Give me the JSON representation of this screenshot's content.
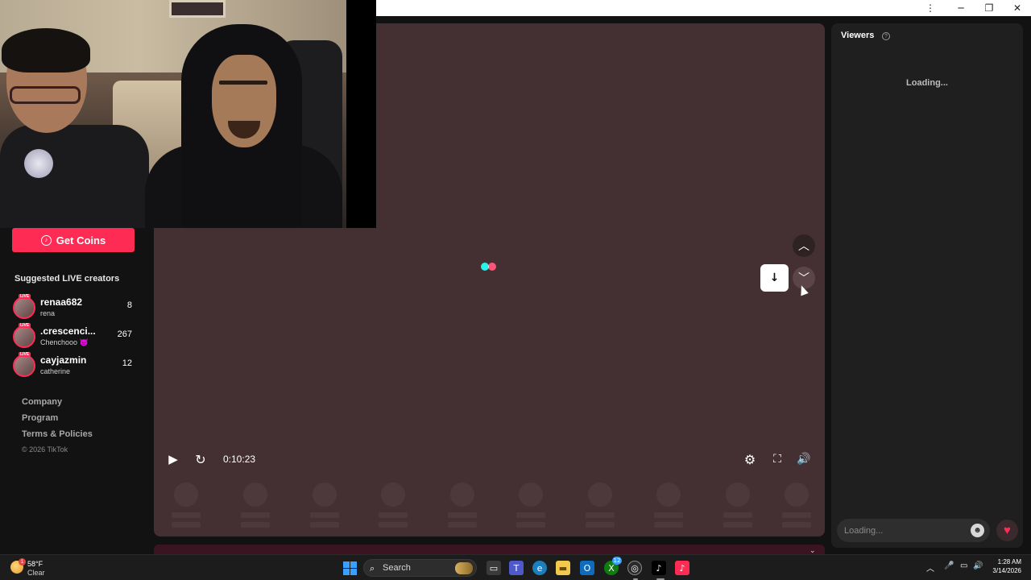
{
  "window": {
    "menu_icon": "kebab-menu-icon",
    "minimize": "minimize-icon",
    "restore": "restore-icon",
    "close": "close-icon"
  },
  "sidebar": {
    "get_coins_label": "Get Coins",
    "suggested_title": "Suggested LIVE creators",
    "creators": [
      {
        "name": "renaa682",
        "sub": "rena",
        "count": "8"
      },
      {
        "name": ".crescenci...",
        "sub": "Chenchooo 😈",
        "count": "267"
      },
      {
        "name": "cayjazmin",
        "sub": "catherine",
        "count": "12"
      }
    ],
    "live_tag": "LIVE",
    "footer": [
      "Company",
      "Program",
      "Terms & Policies"
    ],
    "copyright": "© 2026 TikTok"
  },
  "player": {
    "time": "0:10:23",
    "loader_colors": [
      "#25f4ee",
      "#fe2c55"
    ]
  },
  "viewers": {
    "title": "Viewers",
    "loading": "Loading...",
    "chat_placeholder": "Loading..."
  },
  "taskbar": {
    "weather_temp": "58°F",
    "weather_cond": "Clear",
    "weather_badge": "1",
    "search_label": "Search",
    "time": "1:28 AM",
    "date": "3/14/2026",
    "xbox_badge": "12"
  },
  "colors": {
    "accent": "#fe2c55",
    "video_bg": "#443033",
    "panel_bg": "#1f1f1f"
  }
}
